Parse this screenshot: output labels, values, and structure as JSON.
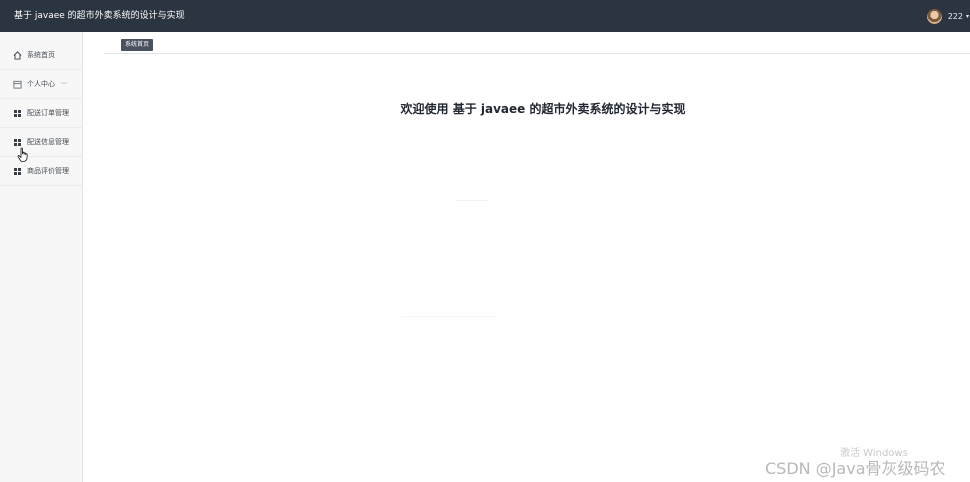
{
  "header": {
    "app_title": "基于 javaee 的超市外卖系统的设计与实现",
    "username": "222",
    "user_caret": "▾"
  },
  "sidebar": {
    "items": [
      {
        "label": "系统首页",
        "icon": "home-icon"
      },
      {
        "label": "个人中心",
        "icon": "calendar-icon",
        "chevron": "﹀"
      },
      {
        "label": "配送订单管理",
        "icon": "grid-icon"
      },
      {
        "label": "配送信息管理",
        "icon": "grid-icon"
      },
      {
        "label": "商品评价管理",
        "icon": "grid-icon"
      }
    ]
  },
  "tabs": {
    "active_label": "系统首页"
  },
  "main": {
    "welcome_text": "欢迎使用 基于 javaee 的超市外卖系统的设计与实现"
  },
  "watermarks": {
    "windows": "激活 Windows",
    "csdn": "CSDN @Java骨灰级码农"
  },
  "colors": {
    "topbar": "#2b3441",
    "sidebar": "#f7f7f7",
    "tab_active": "#4a5260"
  }
}
